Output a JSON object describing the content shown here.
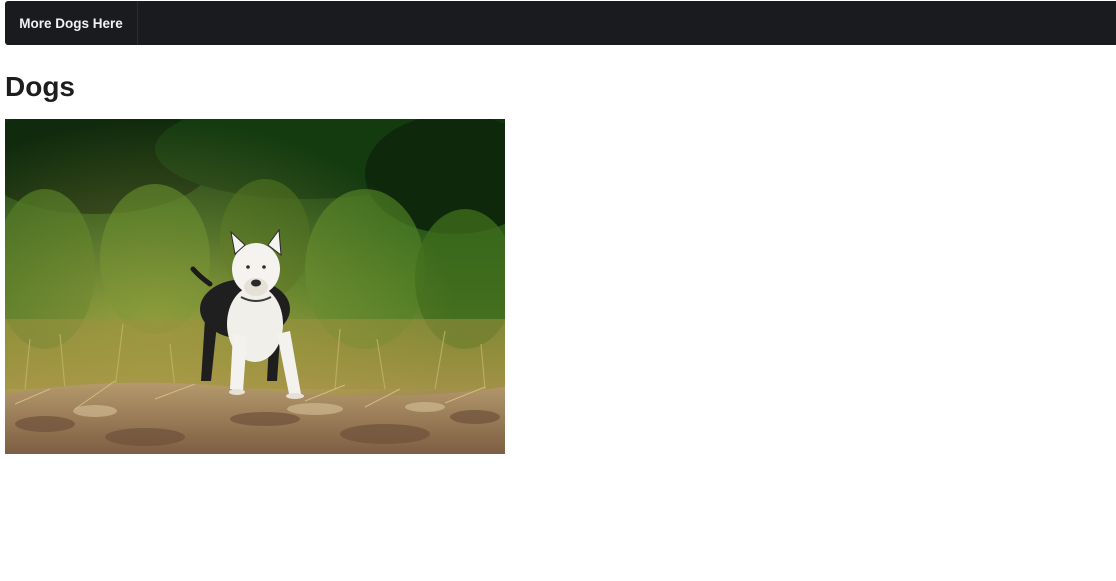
{
  "navbar": {
    "brand_label": "More Dogs Here"
  },
  "main": {
    "title": "Dogs"
  },
  "colors": {
    "navbar_bg": "#1a1b1e",
    "navbar_text": "#f2f2f2",
    "title_text": "#1d1d1d"
  }
}
